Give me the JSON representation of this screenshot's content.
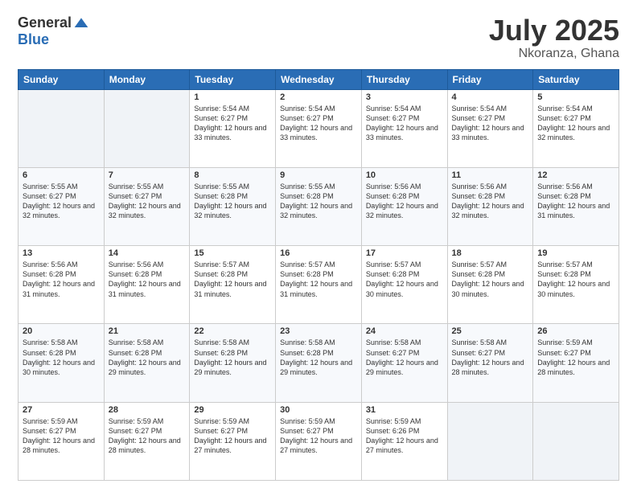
{
  "logo": {
    "general": "General",
    "blue": "Blue"
  },
  "title": "July 2025",
  "location": "Nkoranza, Ghana",
  "headers": [
    "Sunday",
    "Monday",
    "Tuesday",
    "Wednesday",
    "Thursday",
    "Friday",
    "Saturday"
  ],
  "weeks": [
    [
      {
        "day": "",
        "info": ""
      },
      {
        "day": "",
        "info": ""
      },
      {
        "day": "1",
        "info": "Sunrise: 5:54 AM\nSunset: 6:27 PM\nDaylight: 12 hours and 33 minutes."
      },
      {
        "day": "2",
        "info": "Sunrise: 5:54 AM\nSunset: 6:27 PM\nDaylight: 12 hours and 33 minutes."
      },
      {
        "day": "3",
        "info": "Sunrise: 5:54 AM\nSunset: 6:27 PM\nDaylight: 12 hours and 33 minutes."
      },
      {
        "day": "4",
        "info": "Sunrise: 5:54 AM\nSunset: 6:27 PM\nDaylight: 12 hours and 33 minutes."
      },
      {
        "day": "5",
        "info": "Sunrise: 5:54 AM\nSunset: 6:27 PM\nDaylight: 12 hours and 32 minutes."
      }
    ],
    [
      {
        "day": "6",
        "info": "Sunrise: 5:55 AM\nSunset: 6:27 PM\nDaylight: 12 hours and 32 minutes."
      },
      {
        "day": "7",
        "info": "Sunrise: 5:55 AM\nSunset: 6:27 PM\nDaylight: 12 hours and 32 minutes."
      },
      {
        "day": "8",
        "info": "Sunrise: 5:55 AM\nSunset: 6:28 PM\nDaylight: 12 hours and 32 minutes."
      },
      {
        "day": "9",
        "info": "Sunrise: 5:55 AM\nSunset: 6:28 PM\nDaylight: 12 hours and 32 minutes."
      },
      {
        "day": "10",
        "info": "Sunrise: 5:56 AM\nSunset: 6:28 PM\nDaylight: 12 hours and 32 minutes."
      },
      {
        "day": "11",
        "info": "Sunrise: 5:56 AM\nSunset: 6:28 PM\nDaylight: 12 hours and 32 minutes."
      },
      {
        "day": "12",
        "info": "Sunrise: 5:56 AM\nSunset: 6:28 PM\nDaylight: 12 hours and 31 minutes."
      }
    ],
    [
      {
        "day": "13",
        "info": "Sunrise: 5:56 AM\nSunset: 6:28 PM\nDaylight: 12 hours and 31 minutes."
      },
      {
        "day": "14",
        "info": "Sunrise: 5:56 AM\nSunset: 6:28 PM\nDaylight: 12 hours and 31 minutes."
      },
      {
        "day": "15",
        "info": "Sunrise: 5:57 AM\nSunset: 6:28 PM\nDaylight: 12 hours and 31 minutes."
      },
      {
        "day": "16",
        "info": "Sunrise: 5:57 AM\nSunset: 6:28 PM\nDaylight: 12 hours and 31 minutes."
      },
      {
        "day": "17",
        "info": "Sunrise: 5:57 AM\nSunset: 6:28 PM\nDaylight: 12 hours and 30 minutes."
      },
      {
        "day": "18",
        "info": "Sunrise: 5:57 AM\nSunset: 6:28 PM\nDaylight: 12 hours and 30 minutes."
      },
      {
        "day": "19",
        "info": "Sunrise: 5:57 AM\nSunset: 6:28 PM\nDaylight: 12 hours and 30 minutes."
      }
    ],
    [
      {
        "day": "20",
        "info": "Sunrise: 5:58 AM\nSunset: 6:28 PM\nDaylight: 12 hours and 30 minutes."
      },
      {
        "day": "21",
        "info": "Sunrise: 5:58 AM\nSunset: 6:28 PM\nDaylight: 12 hours and 29 minutes."
      },
      {
        "day": "22",
        "info": "Sunrise: 5:58 AM\nSunset: 6:28 PM\nDaylight: 12 hours and 29 minutes."
      },
      {
        "day": "23",
        "info": "Sunrise: 5:58 AM\nSunset: 6:28 PM\nDaylight: 12 hours and 29 minutes."
      },
      {
        "day": "24",
        "info": "Sunrise: 5:58 AM\nSunset: 6:27 PM\nDaylight: 12 hours and 29 minutes."
      },
      {
        "day": "25",
        "info": "Sunrise: 5:58 AM\nSunset: 6:27 PM\nDaylight: 12 hours and 28 minutes."
      },
      {
        "day": "26",
        "info": "Sunrise: 5:59 AM\nSunset: 6:27 PM\nDaylight: 12 hours and 28 minutes."
      }
    ],
    [
      {
        "day": "27",
        "info": "Sunrise: 5:59 AM\nSunset: 6:27 PM\nDaylight: 12 hours and 28 minutes."
      },
      {
        "day": "28",
        "info": "Sunrise: 5:59 AM\nSunset: 6:27 PM\nDaylight: 12 hours and 28 minutes."
      },
      {
        "day": "29",
        "info": "Sunrise: 5:59 AM\nSunset: 6:27 PM\nDaylight: 12 hours and 27 minutes."
      },
      {
        "day": "30",
        "info": "Sunrise: 5:59 AM\nSunset: 6:27 PM\nDaylight: 12 hours and 27 minutes."
      },
      {
        "day": "31",
        "info": "Sunrise: 5:59 AM\nSunset: 6:26 PM\nDaylight: 12 hours and 27 minutes."
      },
      {
        "day": "",
        "info": ""
      },
      {
        "day": "",
        "info": ""
      }
    ]
  ]
}
